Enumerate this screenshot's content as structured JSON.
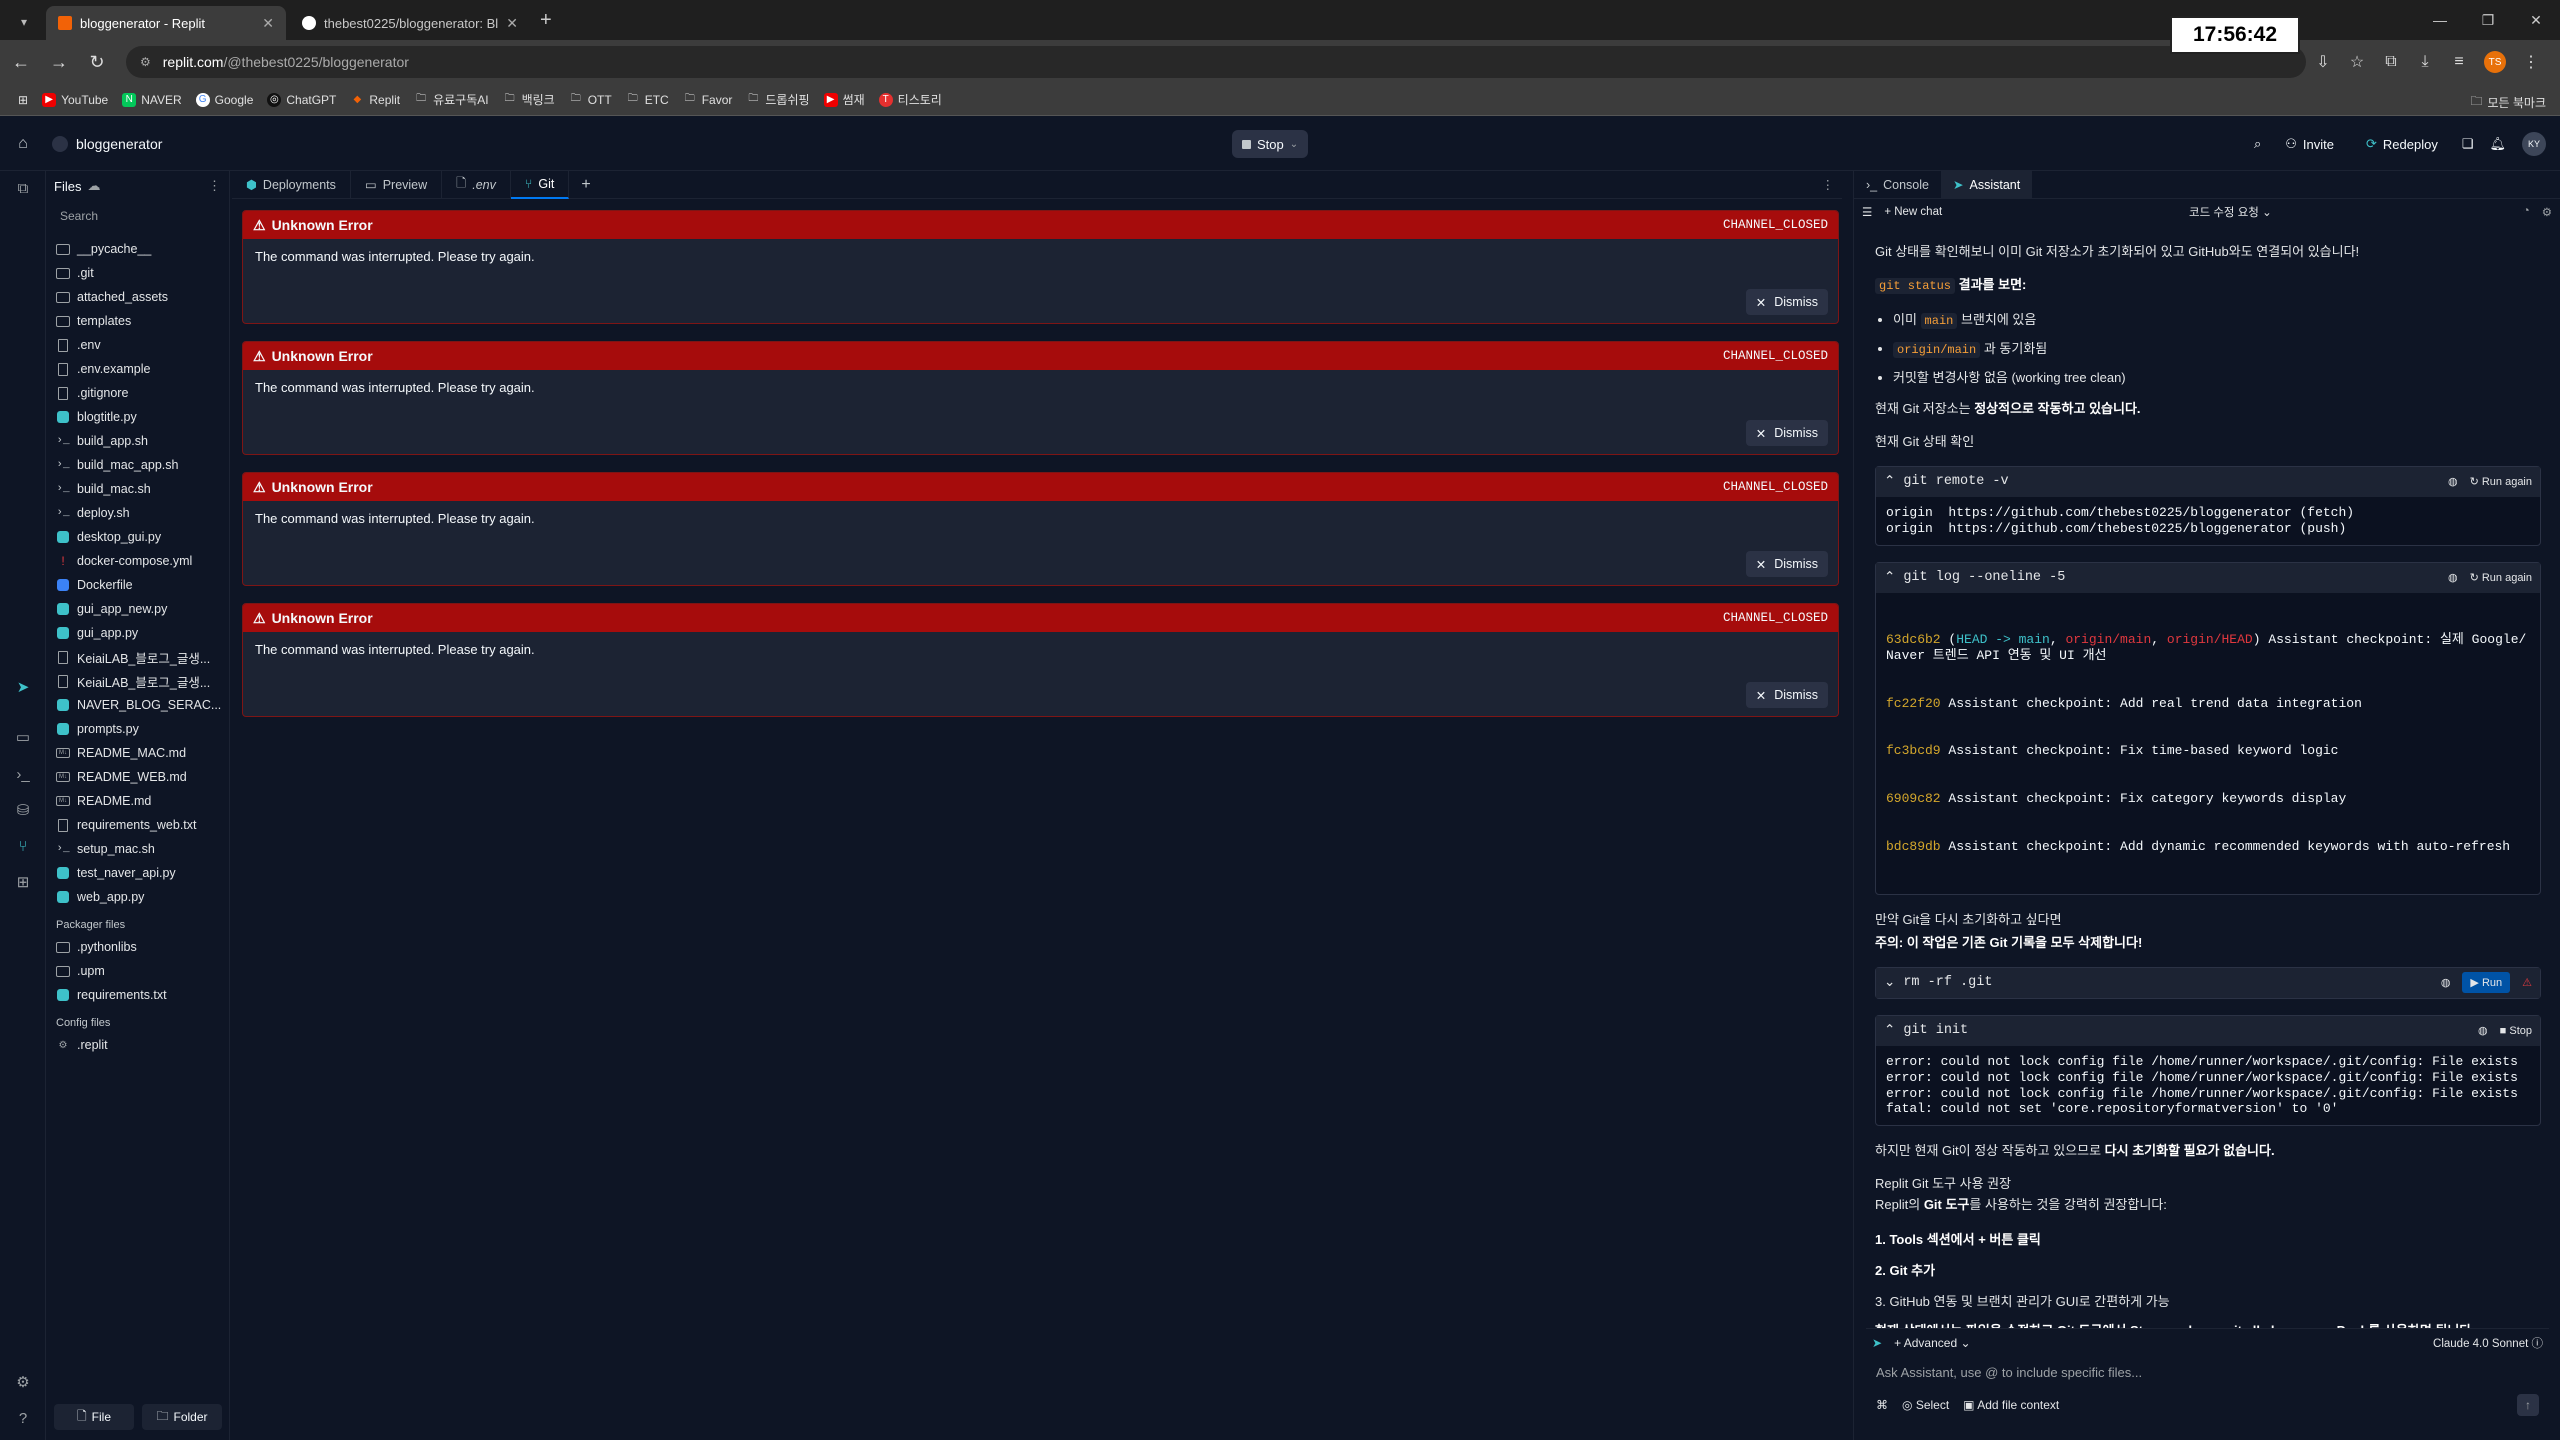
{
  "browser": {
    "tabs": [
      {
        "title": "bloggenerator - Replit",
        "active": true
      },
      {
        "title": "thebest0225/bloggenerator: Bl",
        "active": false
      }
    ],
    "url_host": "replit.com",
    "url_path": "/@thebest0225/bloggenerator",
    "profile_initials": "TS",
    "clock": "17:56:42",
    "bookmarks": [
      "YouTube",
      "NAVER",
      "Google",
      "ChatGPT",
      "Replit",
      "유료구독AI",
      "백링크",
      "OTT",
      "ETC",
      "Favor",
      "드롭쉬핑",
      "썸재",
      "티스토리"
    ],
    "all_bookmarks": "모든 북마크"
  },
  "header": {
    "project": "bloggenerator",
    "stop": "Stop",
    "invite": "Invite",
    "redeploy": "Redeploy",
    "avatar": "KY"
  },
  "files": {
    "title": "Files",
    "search_placeholder": "Search",
    "items": [
      {
        "name": "__pycache__",
        "icon": "folder"
      },
      {
        "name": ".git",
        "icon": "folder"
      },
      {
        "name": "attached_assets",
        "icon": "folder"
      },
      {
        "name": "templates",
        "icon": "folder"
      },
      {
        "name": ".env",
        "icon": "doc"
      },
      {
        "name": ".env.example",
        "icon": "doc"
      },
      {
        "name": ".gitignore",
        "icon": "doc"
      },
      {
        "name": "blogtitle.py",
        "icon": "py"
      },
      {
        "name": "build_app.sh",
        "icon": "sh"
      },
      {
        "name": "build_mac_app.sh",
        "icon": "sh"
      },
      {
        "name": "build_mac.sh",
        "icon": "sh"
      },
      {
        "name": "deploy.sh",
        "icon": "sh"
      },
      {
        "name": "desktop_gui.py",
        "icon": "py"
      },
      {
        "name": "docker-compose.yml",
        "icon": "yml"
      },
      {
        "name": "Dockerfile",
        "icon": "docker"
      },
      {
        "name": "gui_app_new.py",
        "icon": "py"
      },
      {
        "name": "gui_app.py",
        "icon": "py"
      },
      {
        "name": "KeiaiLAB_블로그_글생...",
        "icon": "doc"
      },
      {
        "name": "KeiaiLAB_블로그_글생...",
        "icon": "doc"
      },
      {
        "name": "NAVER_BLOG_SERAC...",
        "icon": "py"
      },
      {
        "name": "prompts.py",
        "icon": "py"
      },
      {
        "name": "README_MAC.md",
        "icon": "md"
      },
      {
        "name": "README_WEB.md",
        "icon": "md"
      },
      {
        "name": "README.md",
        "icon": "md"
      },
      {
        "name": "requirements_web.txt",
        "icon": "doc"
      },
      {
        "name": "setup_mac.sh",
        "icon": "sh"
      },
      {
        "name": "test_naver_api.py",
        "icon": "py"
      },
      {
        "name": "web_app.py",
        "icon": "py"
      }
    ],
    "packager_title": "Packager files",
    "packager_items": [
      {
        "name": ".pythonlibs",
        "icon": "folder"
      },
      {
        "name": ".upm",
        "icon": "folder"
      },
      {
        "name": "requirements.txt",
        "icon": "py"
      }
    ],
    "config_title": "Config files",
    "config_items": [
      {
        "name": ".replit",
        "icon": "replit"
      }
    ],
    "new_file": "File",
    "new_folder": "Folder"
  },
  "editor_tabs": [
    "Deployments",
    "Preview",
    ".env",
    "Git"
  ],
  "errors": [
    {
      "title": "Unknown Error",
      "code": "CHANNEL_CLOSED",
      "message": "The command was interrupted. Please try again.",
      "dismiss": "Dismiss"
    },
    {
      "title": "Unknown Error",
      "code": "CHANNEL_CLOSED",
      "message": "The command was interrupted. Please try again.",
      "dismiss": "Dismiss"
    },
    {
      "title": "Unknown Error",
      "code": "CHANNEL_CLOSED",
      "message": "The command was interrupted. Please try again.",
      "dismiss": "Dismiss"
    },
    {
      "title": "Unknown Error",
      "code": "CHANNEL_CLOSED",
      "message": "The command was interrupted. Please try again.",
      "dismiss": "Dismiss"
    }
  ],
  "right_panel": {
    "tabs": [
      "Console",
      "Assistant"
    ],
    "new_chat": "New chat",
    "request_label": "코드 수정 요청",
    "chat": {
      "p1": "Git 상태를 확인해보니 이미 Git 저장소가 초기화되어 있고 GitHub와도 연결되어 있습니다!",
      "git_status_code": "git status",
      "git_status_tail": " 결과를 보면:",
      "b1_pre": "이미 ",
      "b1_code": "main",
      "b1_post": " 브랜치에 있음",
      "b2_code": "origin/main",
      "b2_post": " 과 동기화됨",
      "b3": "커밋할 변경사항 없음 (working tree clean)",
      "p2_pre": "현재 Git 저장소는 ",
      "p2_bold": "정상적으로 작동하고 있습니다.",
      "p3": "현재 Git 상태 확인",
      "cmd1": "git remote -v",
      "cmd1_out": "origin  https://github.com/thebest0225/bloggenerator (fetch)\norigin  https://github.com/thebest0225/bloggenerator (push)",
      "cmd2": "git log --oneline -5",
      "log": [
        {
          "hash": "63dc6b2",
          "refs": true,
          "msg": " Assistant checkpoint: 실제 Google/Naver 트렌드 API 연동 및 UI 개선"
        },
        {
          "hash": "fc22f20",
          "msg": " Assistant checkpoint: Add real trend data integration"
        },
        {
          "hash": "fc3bcd9",
          "msg": " Assistant checkpoint: Fix time-based keyword logic"
        },
        {
          "hash": "6909c82",
          "msg": " Assistant checkpoint: Fix category keywords display"
        },
        {
          "hash": "bdc89db",
          "msg": " Assistant checkpoint: Add dynamic recommended keywords with auto-refresh"
        }
      ],
      "log_refs": {
        "head": "HEAD -> main",
        "origin_main": "origin/main",
        "origin_head": "origin/HEAD"
      },
      "run_again": "Run again",
      "p4": "만약 Git을 다시 초기화하고 싶다면",
      "p5": "주의: 이 작업은 기존 Git 기록을 모두 삭제합니다!",
      "cmd3": "rm -rf .git",
      "run": "Run",
      "cmd4": "git init",
      "stop": "Stop",
      "cmd4_out": "error: could not lock config file /home/runner/workspace/.git/config: File exists\nerror: could not lock config file /home/runner/workspace/.git/config: File exists\nerror: could not lock config file /home/runner/workspace/.git/config: File exists\nfatal: could not set 'core.repositoryformatversion' to '0'",
      "p6_pre": "하지만 현재 Git이 정상 작동하고 있으므로 ",
      "p6_bold": "다시 초기화할 필요가 없습니다.",
      "p7": "Replit Git 도구 사용 권장",
      "p8_pre": "Replit의 ",
      "p8_bold": "Git 도구",
      "p8_post": "를 사용하는 것을 강력히 권장합니다:",
      "steps": [
        "1. Tools 섹션에서 + 버튼 클릭",
        "2. Git 추가",
        "3. GitHub 연동 및 브랜치 관리가 GUI로 간편하게 가능"
      ],
      "p9": "현재 상태에서는 파일을 수정하고 Git 도구에서 Stage and commit all changes → Push를 사용하면 됩니다."
    },
    "composer": {
      "advanced": "Advanced",
      "model": "Claude 4.0 Sonnet",
      "placeholder": "Ask Assistant, use @ to include specific files...",
      "select": "Select",
      "add_context": "Add file context"
    }
  },
  "colors": {
    "bg": "#0e1525",
    "error_red": "#a60c0c",
    "accent_blue": "#0079f2"
  }
}
